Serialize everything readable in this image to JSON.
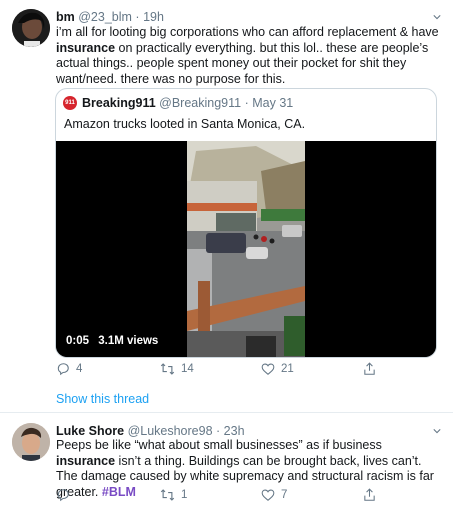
{
  "tweet1": {
    "name": "bm",
    "handle": "@23_blm",
    "sep": "·",
    "time": "19h",
    "text_a": "i’m all for looting big corporations who can afford replacement & have ",
    "text_b": "insurance",
    "text_c": " on practically everything. but this lol.. these are people’s actual things.. people spent money out their pocket for shit they want/need. there was no purpose for this.",
    "quote": {
      "logo": "911",
      "name": "Breaking911",
      "handle": "@Breaking911",
      "sep": "·",
      "date": "May 31",
      "text": "Amazon trucks looted in Santa Monica, CA.",
      "video_time": "0:05",
      "video_views": "3.1M views"
    },
    "actions": {
      "replies": "4",
      "retweets": "14",
      "likes": "21"
    },
    "show_thread": "Show this thread"
  },
  "tweet2": {
    "name": "Luke Shore",
    "handle": "@Lukeshore98",
    "sep": "·",
    "time": "23h",
    "text_a": "Peeps be like “what about small businesses” as if business ",
    "text_b": "insurance",
    "text_c": " isn’t a thing. Buildings can be brought back, lives can’t. The damage caused by white supremacy and structural racism is far greater. ",
    "hashtag": "#BLM",
    "actions": {
      "replies": "",
      "retweets": "1",
      "likes": "7"
    }
  },
  "colors": {
    "link": "#1da1f2",
    "hashtag": "#794bc4",
    "muted": "#657786",
    "border": "#e6ecf0"
  },
  "icons": [
    "chevron-down-icon",
    "reply-icon",
    "retweet-icon",
    "like-icon",
    "share-icon"
  ]
}
